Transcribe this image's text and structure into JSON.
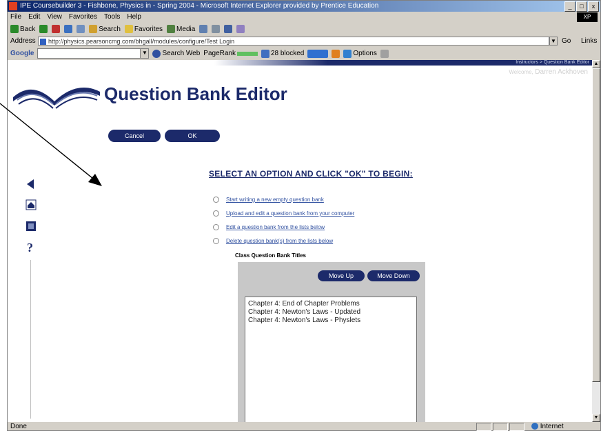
{
  "window": {
    "title": "IPE Coursebuilder 3 - Fishbone, Physics in - Spring 2004 - Microsoft Internet Explorer provided by Prentice Education",
    "buttons": [
      "_",
      "□",
      "x"
    ]
  },
  "menubar": {
    "items": [
      "File",
      "Edit",
      "View",
      "Favorites",
      "Tools",
      "Help"
    ],
    "logo": "XP"
  },
  "toolbar": {
    "back": "Back",
    "search": "Search",
    "favorites": "Favorites",
    "media": "Media"
  },
  "address": {
    "label": "Address",
    "url": "http://physics.pearsoncmg.com/bhgall/modules/configure/Test Login",
    "go": "Go",
    "links": "Links"
  },
  "googlebar": {
    "brand": "Google",
    "search_web": "Search Web",
    "pagerank": "PageRank",
    "blocked": "28 blocked",
    "options": "Options"
  },
  "page": {
    "breadcrumb": "Instructors > Question Bank Editor",
    "welcome_prefix": "Welcome,",
    "welcome_name": "Darren Ackhoven",
    "title": "Question Bank Editor",
    "cancel_label": "Cancel",
    "ok_label": "OK",
    "instruction": "SELECT AN OPTION AND CLICK \"OK\" TO BEGIN:",
    "options": [
      "Start writing a new empty question bank",
      "Upload and edit a question bank from your computer",
      "Edit a question bank from the lists below",
      "Delete question bank(s) from the lists below"
    ],
    "list_heading": "Class Question Bank Titles",
    "move_up": "Move Up",
    "move_down": "Move Down",
    "banks": [
      "Chapter 4: End of Chapter Problems",
      "Chapter 4: Newton's Laws - Updated",
      "Chapter 4: Newton's Laws - Physlets"
    ]
  },
  "status": {
    "left": "Done",
    "zone": "Internet"
  }
}
